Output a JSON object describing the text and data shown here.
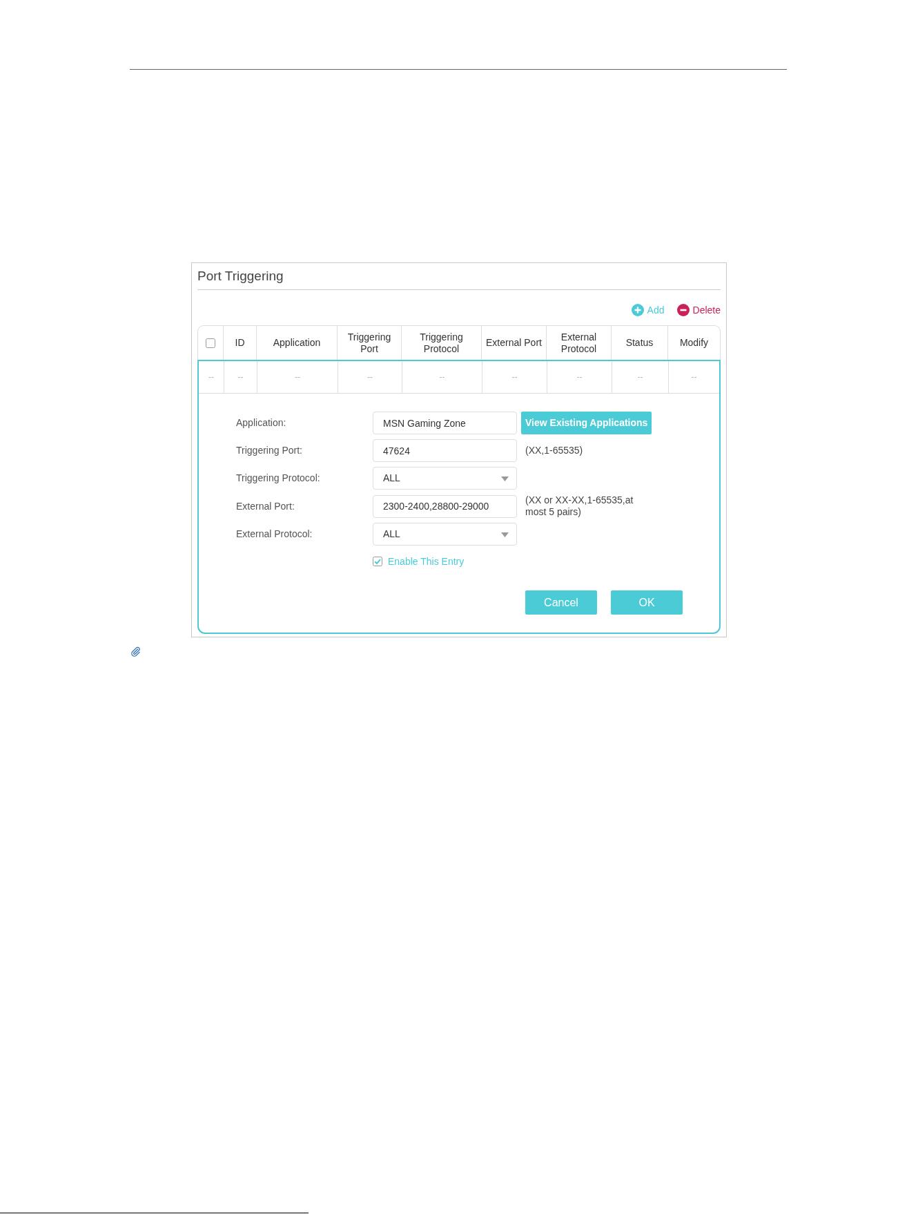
{
  "panel": {
    "title": "Port Triggering"
  },
  "toolbar": [
    {
      "kind": "add",
      "label": "Add"
    },
    {
      "kind": "delete",
      "label": "Delete"
    }
  ],
  "table": {
    "select_all": {
      "checked": false
    },
    "columns": [
      "",
      "ID",
      "Application",
      "Triggering Port",
      "Triggering Protocol",
      "External Port",
      "External Protocol",
      "Status",
      "Modify"
    ],
    "rows": [
      [
        "--",
        "--",
        "--",
        "--",
        "--",
        "--",
        "--",
        "--",
        "--"
      ]
    ]
  },
  "form": {
    "fields": [
      {
        "kind": "text",
        "label": "Application:",
        "value": "MSN Gaming Zone",
        "button": "View Existing Applications"
      },
      {
        "kind": "text",
        "label": "Triggering Port:",
        "value": "47624",
        "hint": "(XX,1-65535)"
      },
      {
        "kind": "select",
        "label": "Triggering Protocol:",
        "value": "ALL"
      },
      {
        "kind": "text",
        "label": "External Port:",
        "value": "2300-2400,28800-29000",
        "hint": "(XX or XX-XX,1-65535,at most 5 pairs)"
      },
      {
        "kind": "select",
        "label": "External Protocol:",
        "value": "ALL"
      }
    ],
    "enable": {
      "label": "Enable This Entry",
      "checked": true
    },
    "buttons": [
      "Cancel",
      "OK"
    ]
  }
}
